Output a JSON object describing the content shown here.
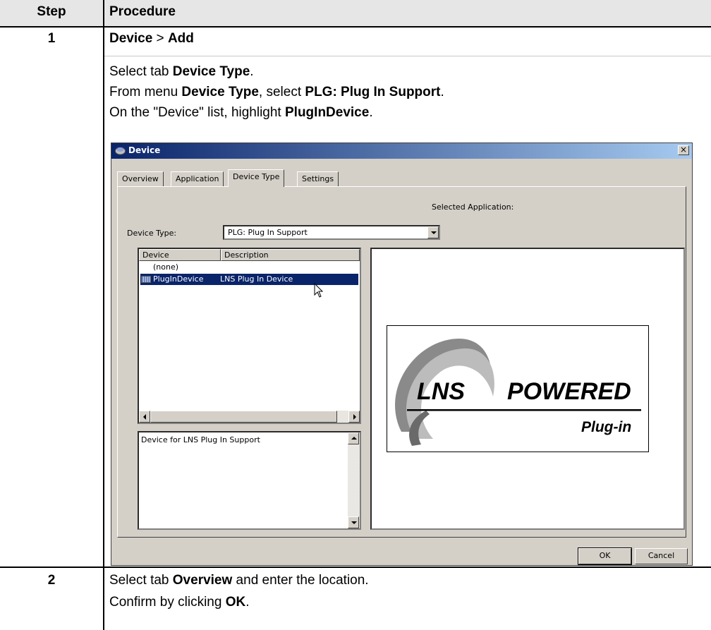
{
  "table": {
    "col_step": "Step",
    "col_procedure": "Procedure"
  },
  "step1": {
    "number": "1",
    "line1": {
      "b1": "Device",
      "sep": " > ",
      "b2": "Add"
    },
    "line2": {
      "t1": "Select tab ",
      "b1": "Device Type",
      "t2": "."
    },
    "line3": {
      "t1": "From menu ",
      "b1": "Device Type",
      "t2": ", select ",
      "b2": "PLG: Plug In Support",
      "t3": "."
    },
    "line4": {
      "t1": "On the \"Device\" list, highlight ",
      "b1": "PlugInDevice",
      "t2": "."
    }
  },
  "dialog": {
    "title": "Device",
    "close_glyph": "×",
    "tabs": [
      "Overview",
      "Application",
      "Device Type",
      "Settings"
    ],
    "active_tab": "Device Type",
    "selected_application_label": "Selected Application:",
    "device_type_label": "Device Type:",
    "device_type_value": "PLG: Plug In Support",
    "list": {
      "columns": [
        "Device",
        "Description"
      ],
      "rows": [
        {
          "device": "(none)",
          "description": ""
        },
        {
          "device": "PlugInDevice",
          "description": "LNS Plug In Device",
          "selected": true
        }
      ]
    },
    "description_text": "Device for LNS Plug In Support",
    "logo": {
      "left": "LNS",
      "right": "POWERED",
      "sub": "Plug-in"
    },
    "ok_label": "OK",
    "cancel_label": "Cancel"
  },
  "step2": {
    "number": "2",
    "line1": {
      "t1": "Select tab ",
      "b1": "Overview",
      "t2": " and enter the location."
    },
    "line2": {
      "t1": "Confirm by clicking ",
      "b1": "OK",
      "t2": "."
    }
  },
  "colors": {
    "header_bg": "#e6e6e6",
    "titlebar_start": "#0a246a",
    "titlebar_end": "#a6caf0",
    "dialog_face": "#d4d0c8",
    "selection": "#0a246a"
  }
}
